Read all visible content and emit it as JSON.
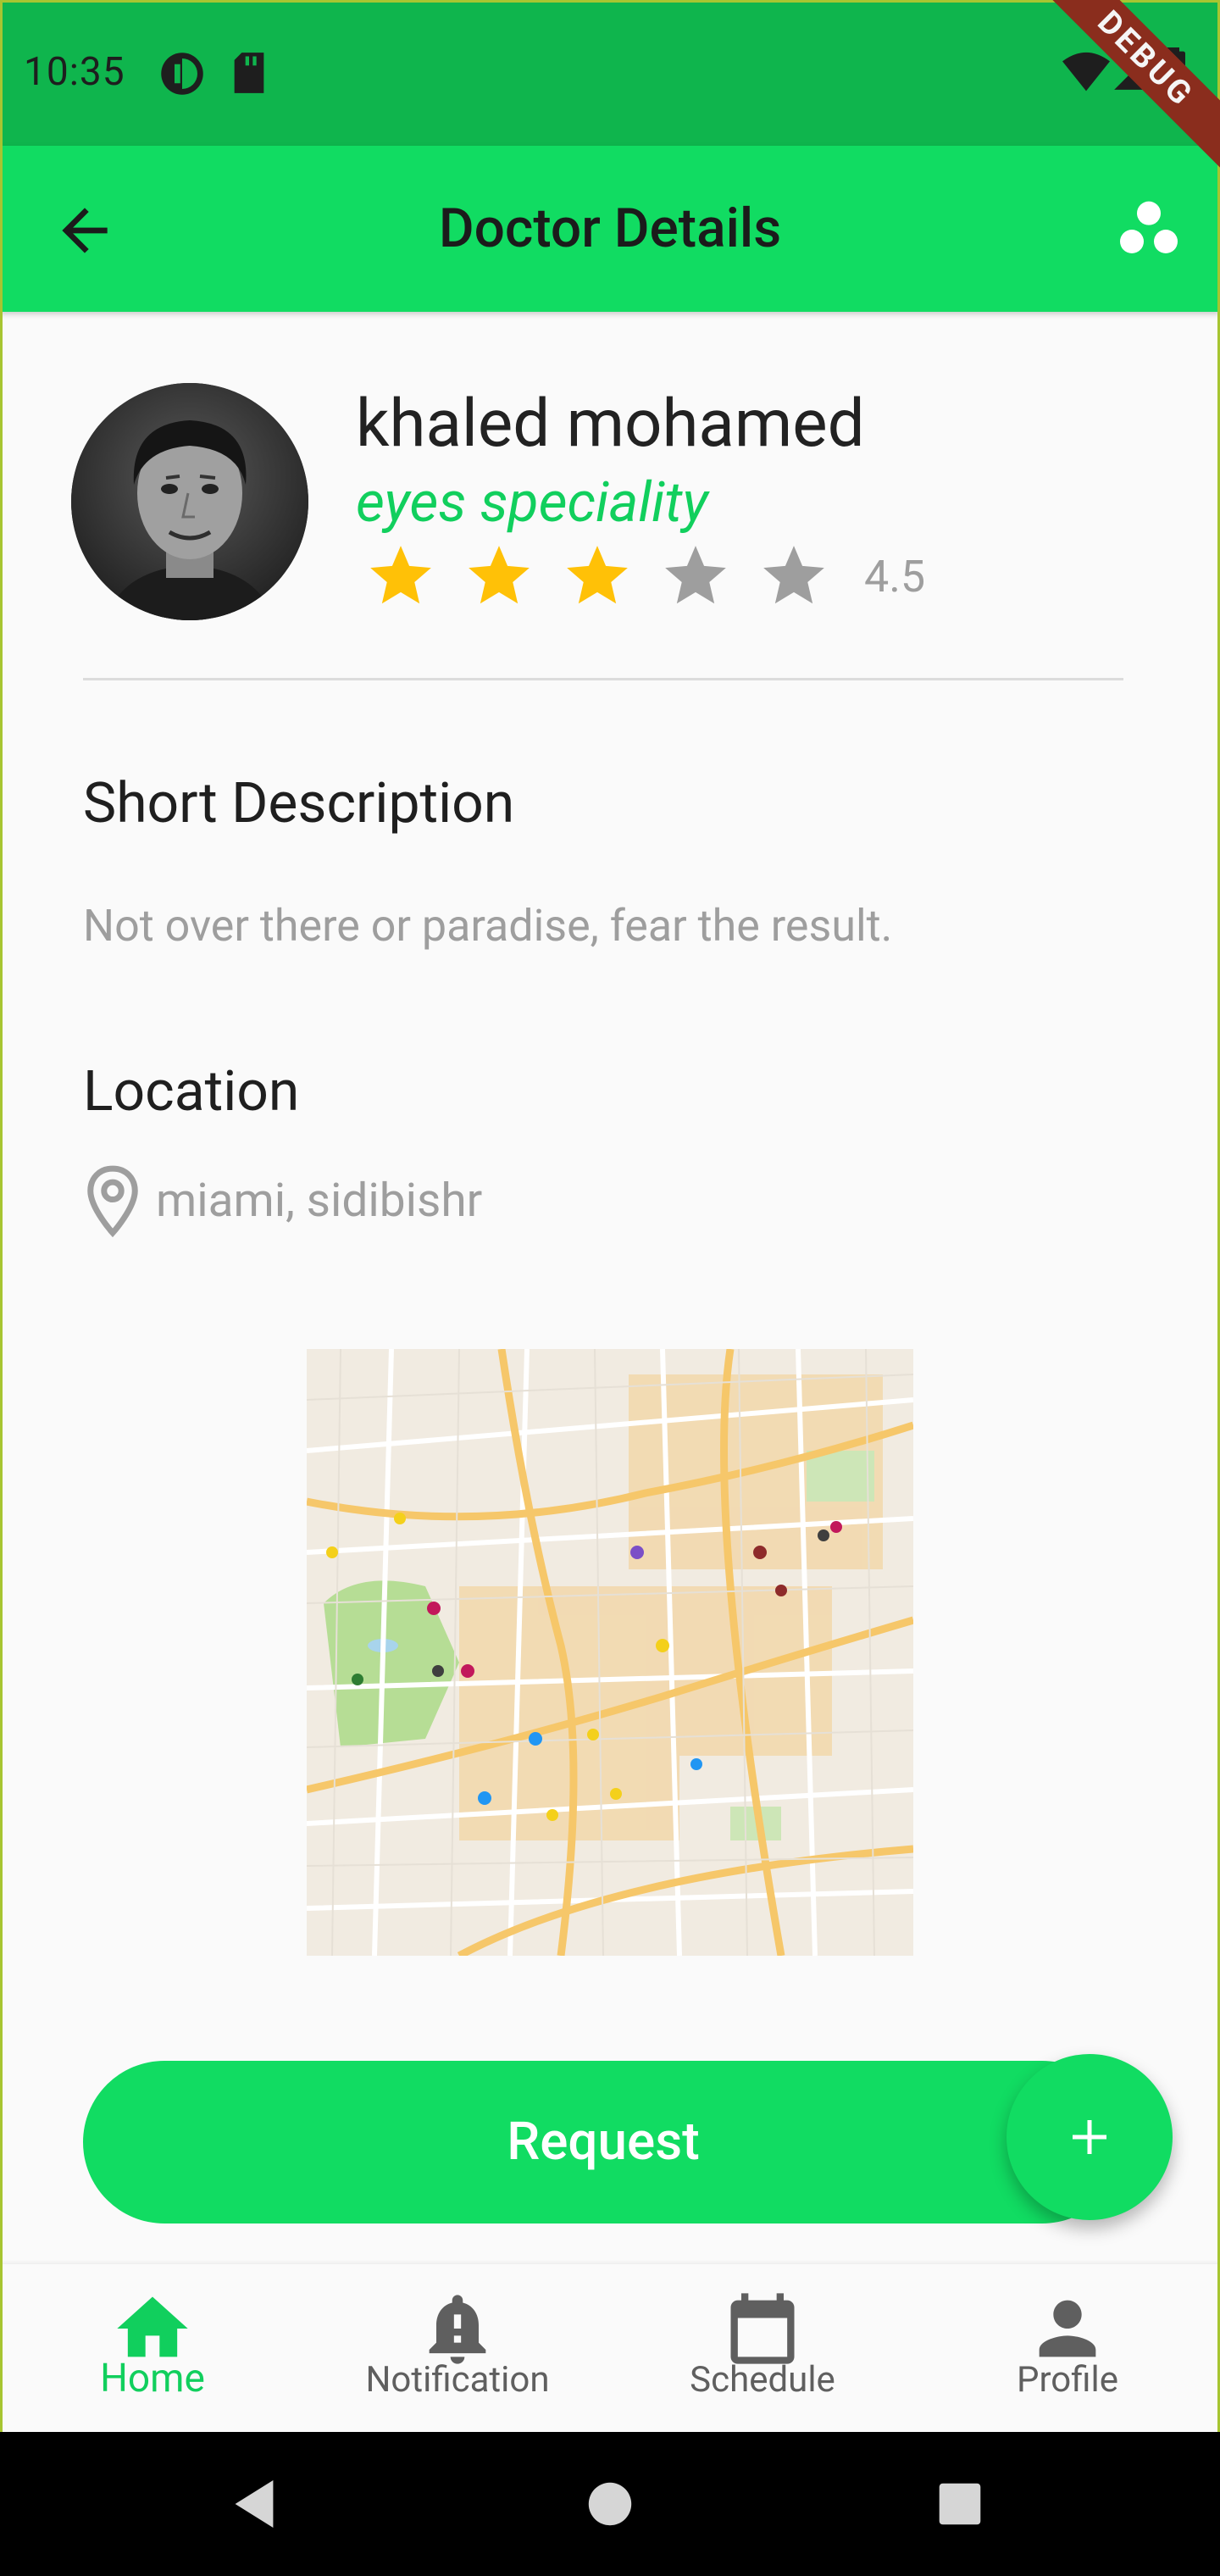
{
  "status_bar": {
    "time": "10:35",
    "debug_label": "DEBUG"
  },
  "app_bar": {
    "title": "Doctor Details"
  },
  "doctor": {
    "name": "khaled mohamed",
    "speciality": "eyes speciality",
    "rating": "4.5",
    "stars_filled": 3,
    "stars_total": 5
  },
  "description": {
    "title": "Short Description",
    "text": "Not over there or paradise, fear the result."
  },
  "location": {
    "title": "Location",
    "address": "miami, sidibishr"
  },
  "actions": {
    "request_label": "Request",
    "fab_icon": "plus-icon"
  },
  "bottom_nav": {
    "items": [
      {
        "label": "Home",
        "icon": "home-icon",
        "active": true
      },
      {
        "label": "Notification",
        "icon": "bell-icon",
        "active": false
      },
      {
        "label": "Schedule",
        "icon": "calendar-icon",
        "active": false
      },
      {
        "label": "Profile",
        "icon": "person-icon",
        "active": false
      }
    ]
  },
  "colors": {
    "primary": "#11dc62",
    "status_bar": "#0fb54d",
    "star_active": "#ffc107",
    "star_inactive": "#9e9e9e"
  }
}
